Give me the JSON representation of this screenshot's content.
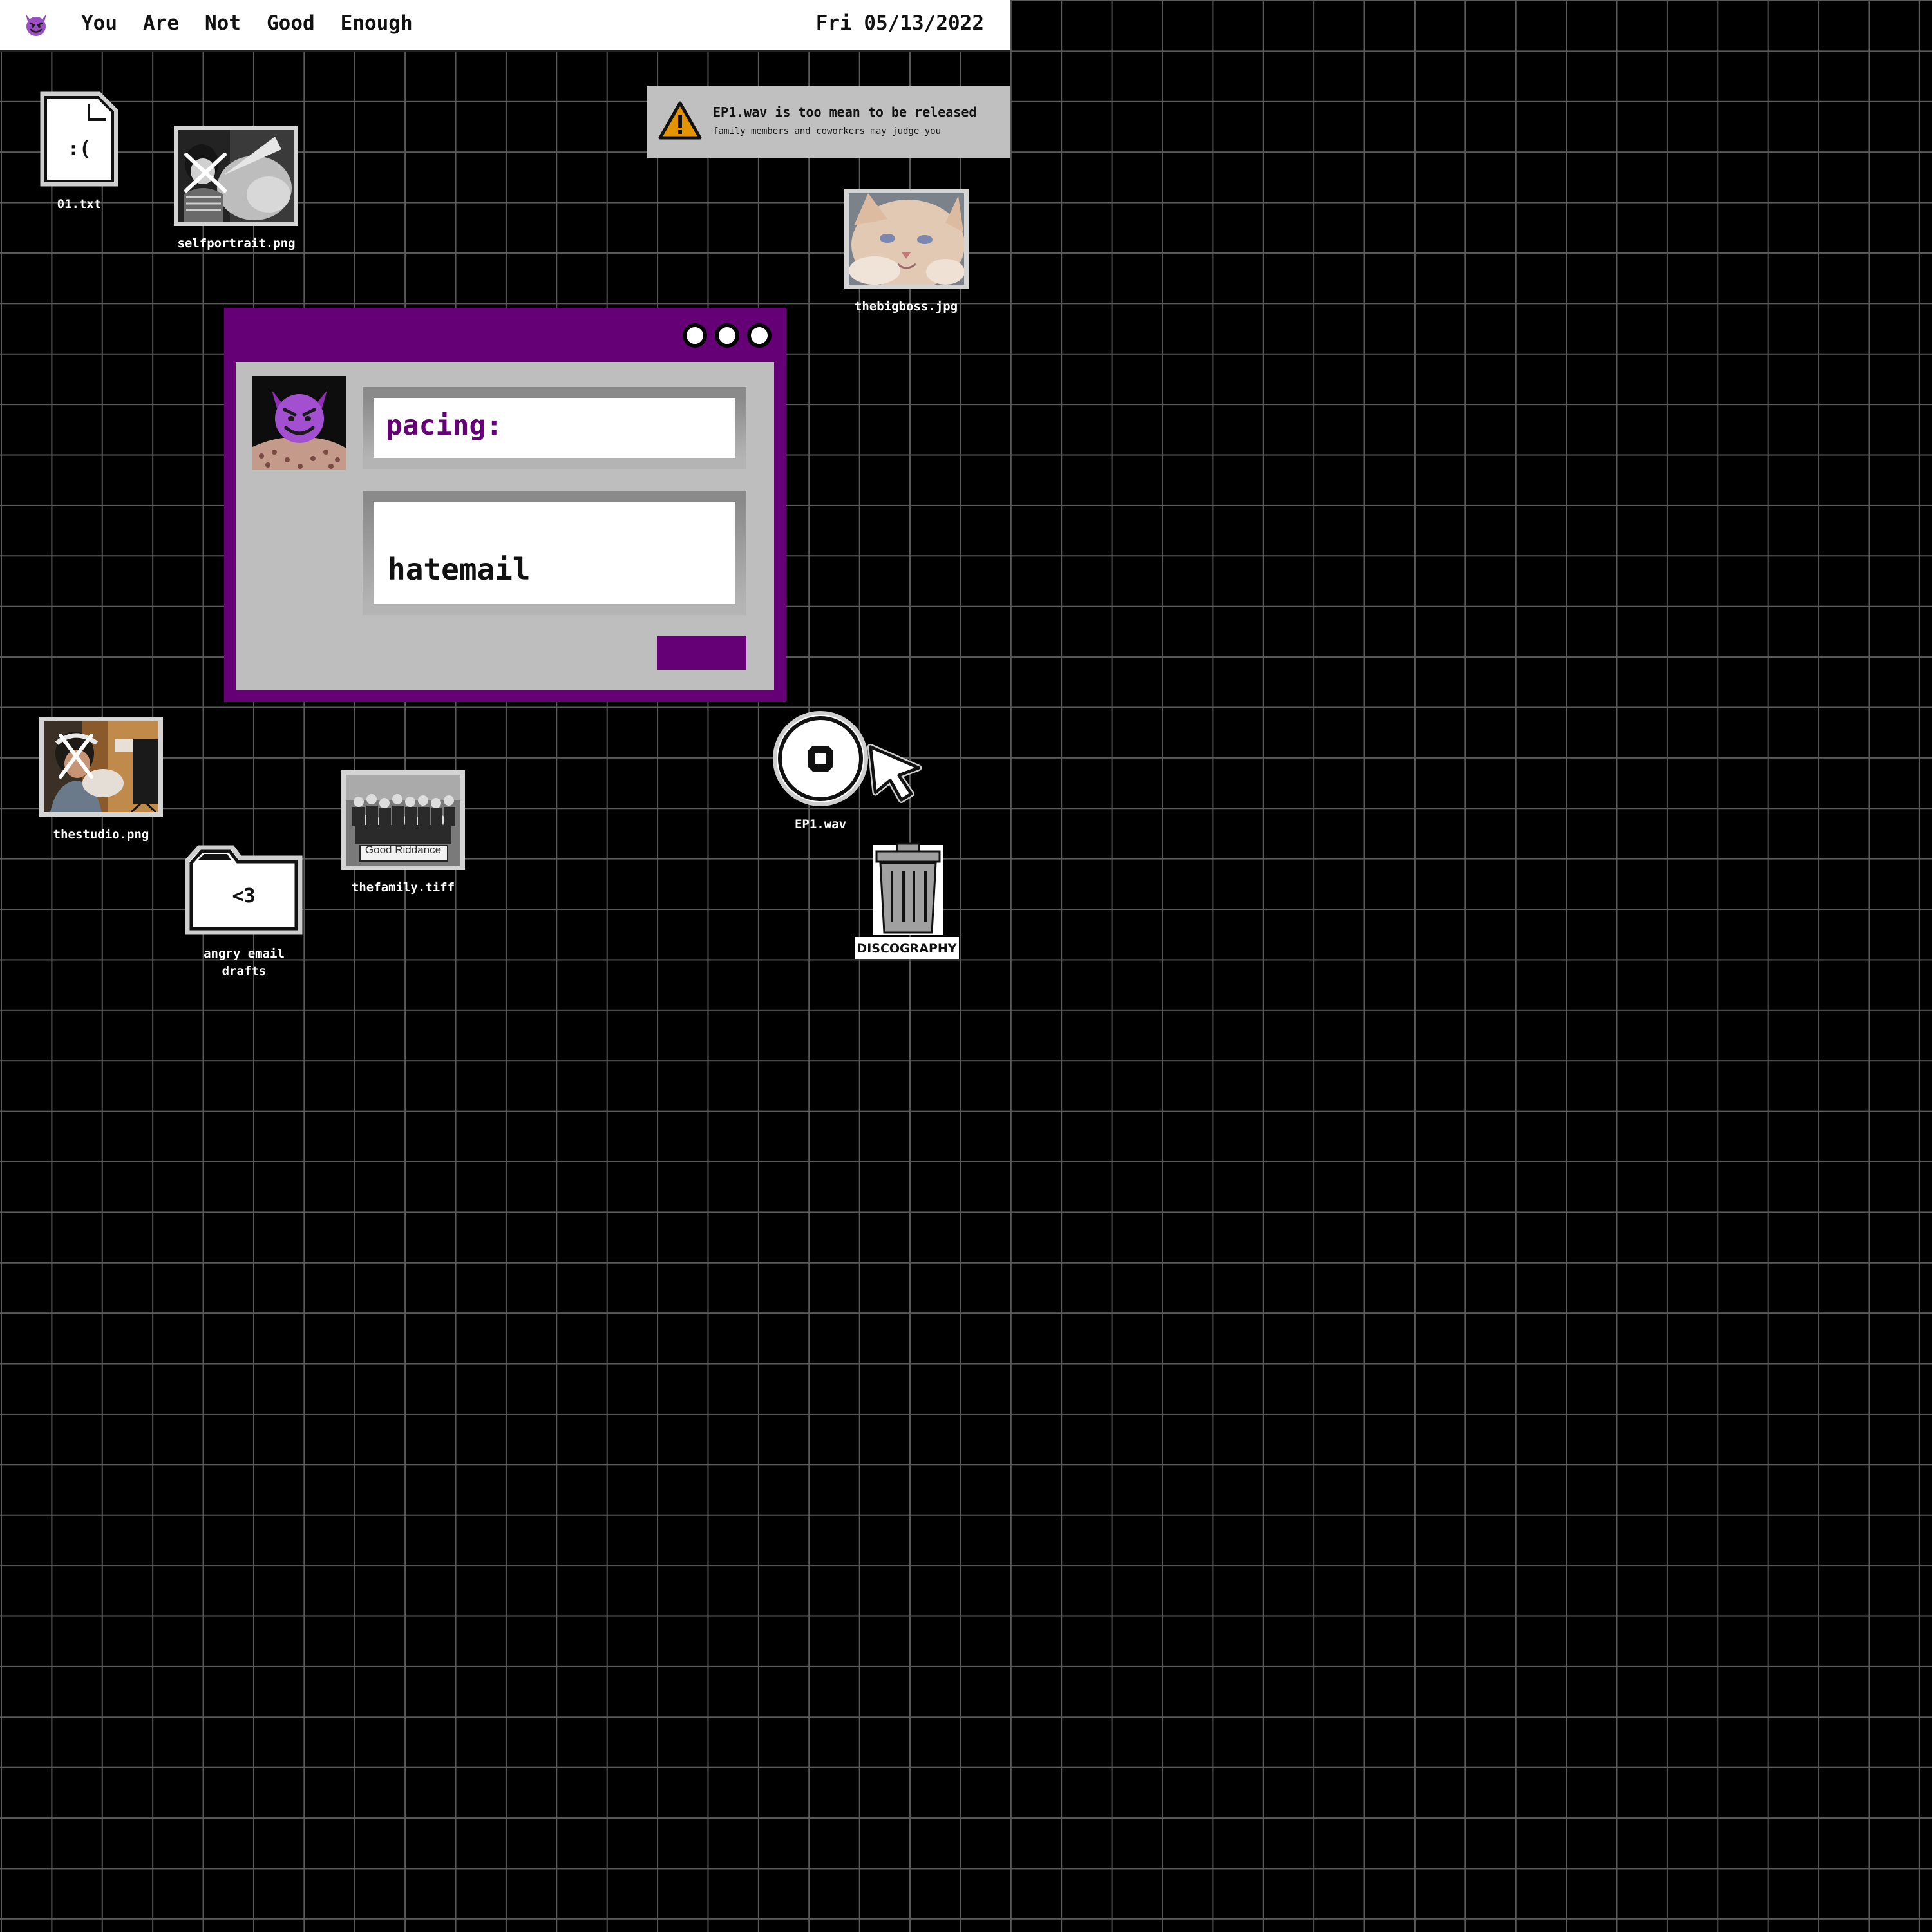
{
  "menubar": {
    "logo_icon": "smiling-devil-icon",
    "title_words": [
      "You",
      "Are",
      "Not",
      "Good",
      "Enough"
    ],
    "date": "Fri 05/13/2022"
  },
  "desktop": {
    "file_txt": {
      "icon": "document-icon",
      "face": ":(",
      "label": "01.txt"
    },
    "selfportrait": {
      "label": "selfportrait.png"
    },
    "thebigboss": {
      "label": "thebigboss.jpg"
    },
    "thestudio": {
      "label": "thestudio.png"
    },
    "folder": {
      "icon": "folder-icon",
      "face": "<3",
      "label_line1": "angry email",
      "label_line2": "drafts"
    },
    "thefamily": {
      "label": "thefamily.tiff",
      "sign_text": "Good Riddance"
    },
    "ep1": {
      "icon": "cd-disc-icon",
      "label": "EP1.wav"
    },
    "trash": {
      "icon": "trash-can-icon",
      "label": "DISCOGRAPHY"
    }
  },
  "notice": {
    "icon": "warning-icon",
    "title": "EP1.wav is too mean to be released",
    "subtitle": "family members and coworkers may judge you"
  },
  "window": {
    "avatar_icon": "smiling-devil-icon",
    "field1_value": "pacing:",
    "field2_value": "hatemail"
  },
  "colors": {
    "accent_purple": "#660077",
    "warning_orange": "#e39400",
    "window_body": "#bebebe"
  }
}
